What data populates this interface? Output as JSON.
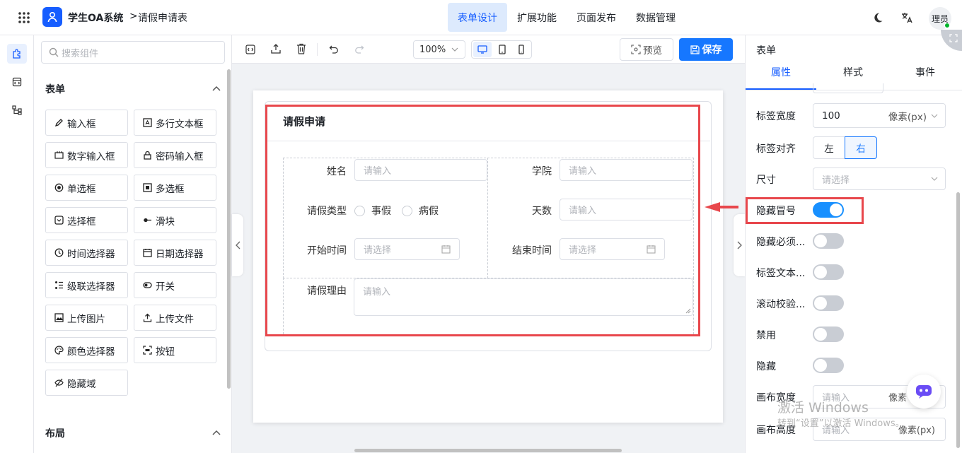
{
  "header": {
    "app_title": "学生OA系统",
    "breadcrumb_sep": ">",
    "breadcrumb": "请假申请表",
    "tabs": [
      {
        "label": "表单设计",
        "active": true
      },
      {
        "label": "扩展功能"
      },
      {
        "label": "页面发布"
      },
      {
        "label": "数据管理"
      }
    ],
    "avatar_text": "理员",
    "accent": "#165dff"
  },
  "palette": {
    "search_placeholder": "搜索组件",
    "form_section": "表单",
    "layout_section": "布局",
    "items": [
      {
        "label": "输入框",
        "icon": "pencil-icon"
      },
      {
        "label": "多行文本框",
        "icon": "textarea-icon"
      },
      {
        "label": "数字输入框",
        "icon": "number-icon"
      },
      {
        "label": "密码输入框",
        "icon": "lock-icon"
      },
      {
        "label": "单选框",
        "icon": "radio-icon"
      },
      {
        "label": "多选框",
        "icon": "checkbox-icon"
      },
      {
        "label": "选择框",
        "icon": "select-icon"
      },
      {
        "label": "滑块",
        "icon": "slider-icon"
      },
      {
        "label": "时间选择器",
        "icon": "clock-icon"
      },
      {
        "label": "日期选择器",
        "icon": "calendar-icon"
      },
      {
        "label": "级联选择器",
        "icon": "cascader-icon"
      },
      {
        "label": "开关",
        "icon": "switch-icon"
      },
      {
        "label": "上传图片",
        "icon": "image-icon"
      },
      {
        "label": "上传文件",
        "icon": "upload-icon"
      },
      {
        "label": "颜色选择器",
        "icon": "palette-icon"
      },
      {
        "label": "按钮",
        "icon": "button-icon"
      },
      {
        "label": "隐藏域",
        "icon": "eye-off-icon"
      }
    ]
  },
  "toolbar": {
    "zoom": "100%",
    "preview": "预览",
    "save": "保存"
  },
  "form": {
    "title": "请假申请",
    "name_label": "姓名",
    "name_placeholder": "请输入",
    "college_label": "学院",
    "college_placeholder": "请输入",
    "type_label": "请假类型",
    "type_options": [
      "事假",
      "病假"
    ],
    "days_label": "天数",
    "days_placeholder": "请输入",
    "start_label": "开始时间",
    "start_placeholder": "请选择",
    "end_label": "结束时间",
    "end_placeholder": "请选择",
    "reason_label": "请假理由",
    "reason_placeholder": "请输入",
    "highlight_color": "#e8474c"
  },
  "props": {
    "title": "表单",
    "tabs": [
      "属性",
      "样式",
      "事件"
    ],
    "label_width_label": "标签宽度",
    "label_width_value": "100",
    "label_width_unit": "像素(px)",
    "label_align_label": "标签对齐",
    "align_left": "左",
    "align_right": "右",
    "size_label": "尺寸",
    "size_placeholder": "请选择",
    "hide_colon_label": "隐藏冒号",
    "hide_colon_on": true,
    "hide_required_label": "隐藏必须...",
    "label_text_label": "标签文本...",
    "scroll_validate_label": "滚动校验...",
    "disabled_label": "禁用",
    "hidden_label": "隐藏",
    "canvas_width_label": "画布宽度",
    "canvas_width_placeholder": "请输入",
    "canvas_width_unit": "像素",
    "canvas_height_label": "画布高度",
    "canvas_height_placeholder": "请输入",
    "canvas_height_unit": "像素(px)"
  },
  "watermark": {
    "line1": "激活 Windows",
    "line2": "转到“设置”以激活 Windows。"
  }
}
